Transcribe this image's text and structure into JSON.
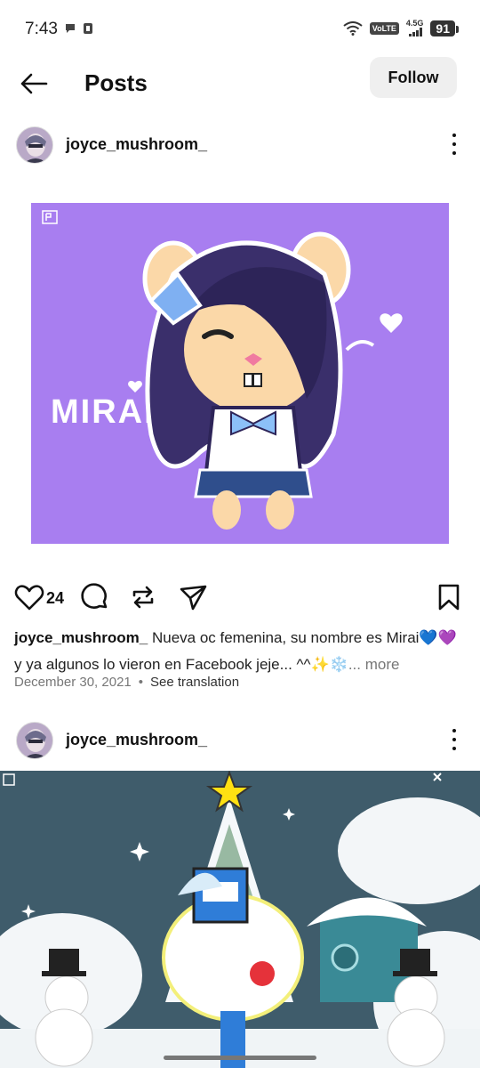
{
  "status_bar": {
    "time": "7:43",
    "volte": "VoLTE",
    "network": "4.5G",
    "battery": "91"
  },
  "header": {
    "title": "Posts",
    "follow_label": "Follow"
  },
  "posts": [
    {
      "username": "joyce_mushroom_",
      "image_text": "MIRAI",
      "likes": "24",
      "caption_user": "joyce_mushroom_",
      "caption_text": " Nueva oc femenina, su nombre es Mirai💙💜 y ya algunos lo vieron en Facebook jeje... ^^✨❄️",
      "caption_more": "... more",
      "date": "December 30, 2021",
      "separator": "•",
      "translate_label": "See translation"
    },
    {
      "username": "joyce_mushroom_"
    }
  ],
  "icons": {
    "back": "arrow-left-icon",
    "more": "more-vertical-icon",
    "like": "heart-icon",
    "comment": "comment-icon",
    "repost": "repost-icon",
    "share": "send-icon",
    "save": "bookmark-icon"
  },
  "colors": {
    "image1_background": "#a87ef0",
    "follow_button_bg": "#efefef",
    "image2_background": "#3d5a6a"
  }
}
